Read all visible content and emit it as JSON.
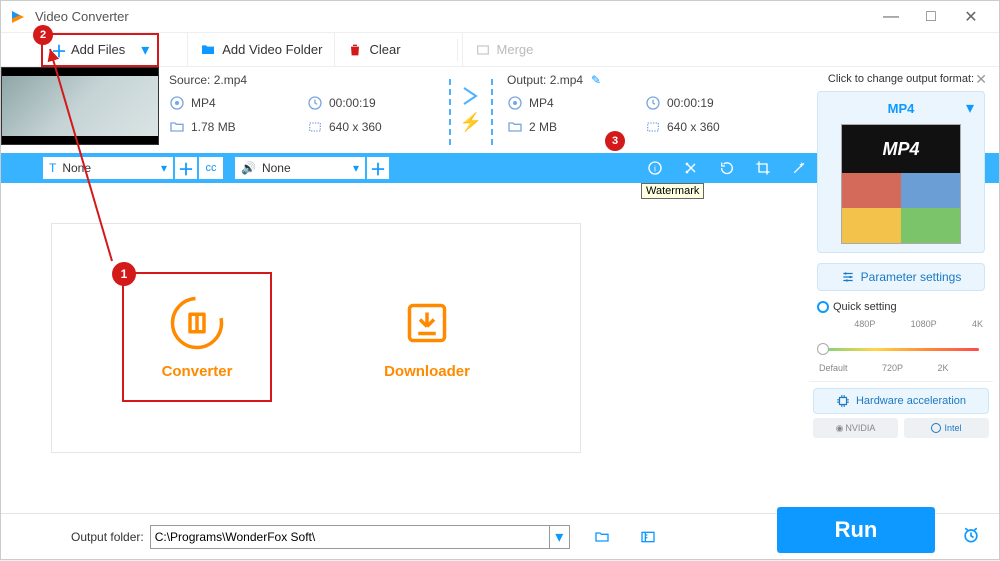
{
  "window": {
    "title": "Video Converter"
  },
  "toolbar": {
    "add_files": "Add Files",
    "add_folder": "Add Video Folder",
    "clear": "Clear",
    "merge": "Merge"
  },
  "callouts": {
    "b1": "1",
    "b2": "2",
    "b3": "3"
  },
  "file": {
    "source_label": "Source: 2.mp4",
    "output_label": "Output: 2.mp4",
    "src": {
      "container": "MP4",
      "duration": "00:00:19",
      "size": "1.78 MB",
      "resolution": "640 x 360"
    },
    "out": {
      "container": "MP4",
      "duration": "00:00:19",
      "size": "2 MB",
      "resolution": "640 x 360"
    }
  },
  "bluebar": {
    "subtitle_mode": "None",
    "audio_mode": "None",
    "tooltip": "Watermark"
  },
  "cards": {
    "converter": "Converter",
    "downloader": "Downloader"
  },
  "sidebar": {
    "hint": "Click to change output format:",
    "format": "MP4",
    "param_settings": "Parameter settings",
    "quick_setting": "Quick setting",
    "scale": {
      "lo": "Default",
      "p480": "480P",
      "p720": "720P",
      "p1080": "1080P",
      "k2": "2K",
      "k4": "4K"
    },
    "hw_accel": "Hardware acceleration",
    "nvidia": "NVIDIA",
    "intel": "Intel"
  },
  "footer": {
    "label": "Output folder:",
    "path": "C:\\Programs\\WonderFox Soft\\",
    "run": "Run"
  }
}
